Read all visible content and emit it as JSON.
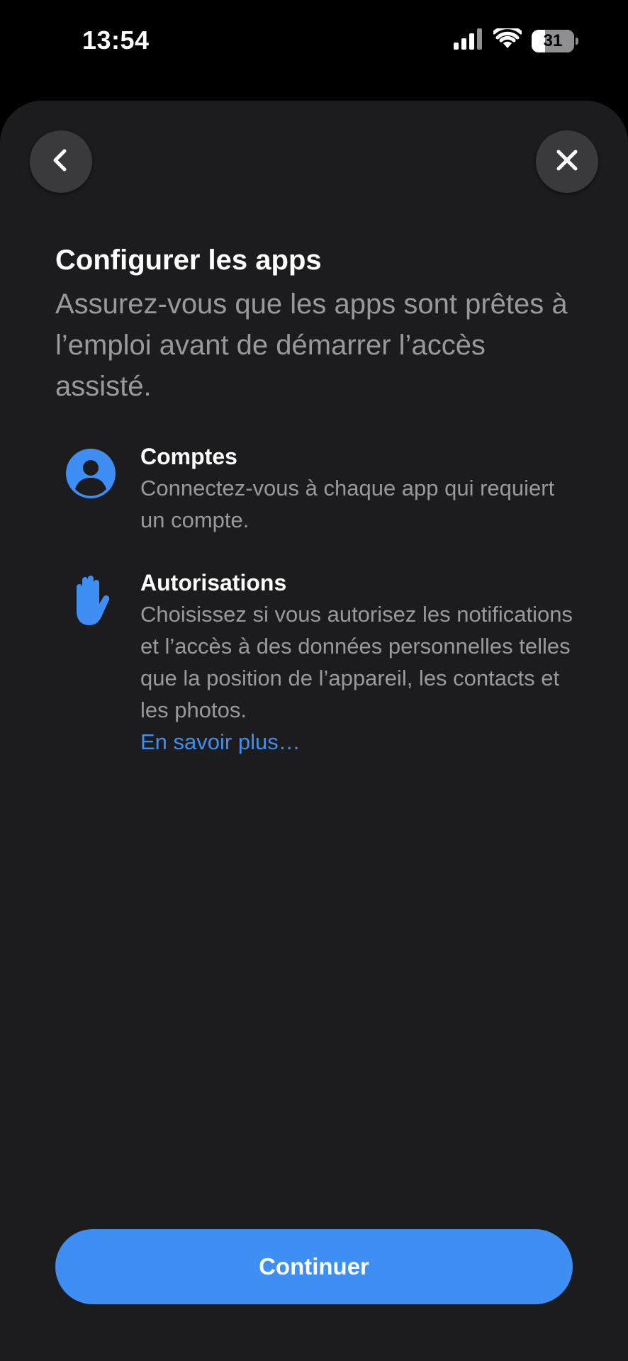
{
  "status_bar": {
    "time": "13:54",
    "battery_level": "31",
    "battery_fraction": 0.31,
    "icons": [
      "cellular-signal-icon",
      "wifi-icon",
      "battery-icon"
    ]
  },
  "nav": {
    "back_icon": "chevron-left-icon",
    "close_icon": "close-icon"
  },
  "header": {
    "title": "Configurer les apps",
    "subtitle": "Assurez-vous que les apps sont prêtes à l’emploi avant de démarrer l’accès assisté."
  },
  "features": [
    {
      "icon": "person-circle-icon",
      "title": "Comptes",
      "body": "Connectez-vous à chaque app qui requiert un compte."
    },
    {
      "icon": "raised-hand-icon",
      "title": "Autorisations",
      "body": "Choisissez si vous autorisez les notifications et l’accès à des données personnelles telles que la position de l’appareil, les contacts et les photos.",
      "link": "En savoir plus…"
    }
  ],
  "footer": {
    "continue_label": "Continuer"
  },
  "colors": {
    "accent": "#3e8ef4",
    "sheet_background": "#1c1c1e",
    "secondary_text": "#98989f"
  }
}
